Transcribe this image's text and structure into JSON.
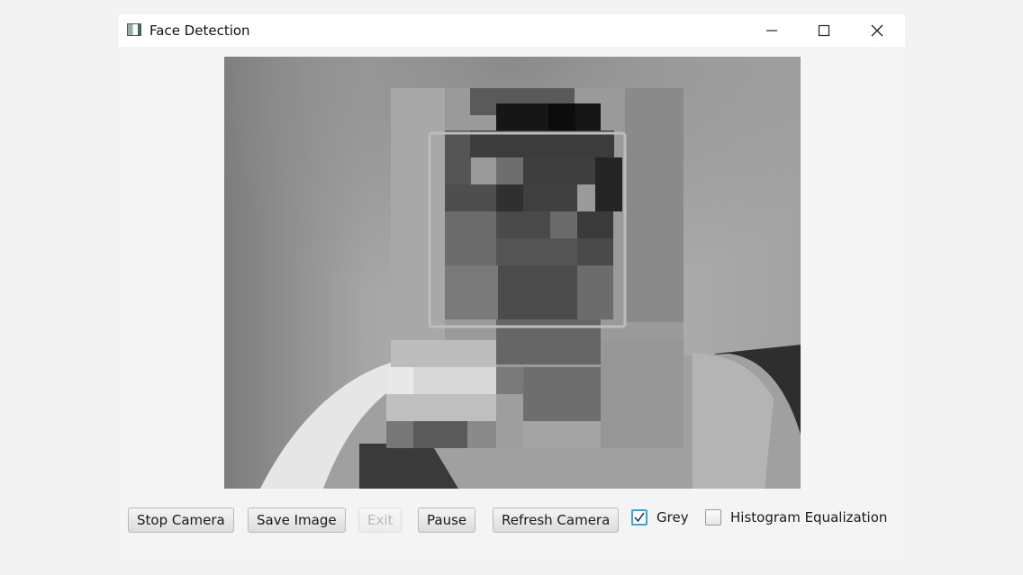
{
  "window": {
    "title": "Face Detection",
    "minimize_icon": "minimize-icon",
    "maximize_icon": "maximize-icon",
    "close_icon": "close-icon"
  },
  "video": {
    "description_icon": "camera-feed"
  },
  "toolbar": {
    "stop_camera": "Stop Camera",
    "save_image": "Save Image",
    "exit": "Exit",
    "pause": "Pause",
    "refresh_camera": "Refresh Camera",
    "grey_label": "Grey",
    "grey_checked": true,
    "histogram_label": "Histogram Equalization",
    "histogram_checked": false
  },
  "colors": {
    "checkbox_accent": "#3aa3e8",
    "face_box": "#bdbdbd"
  }
}
